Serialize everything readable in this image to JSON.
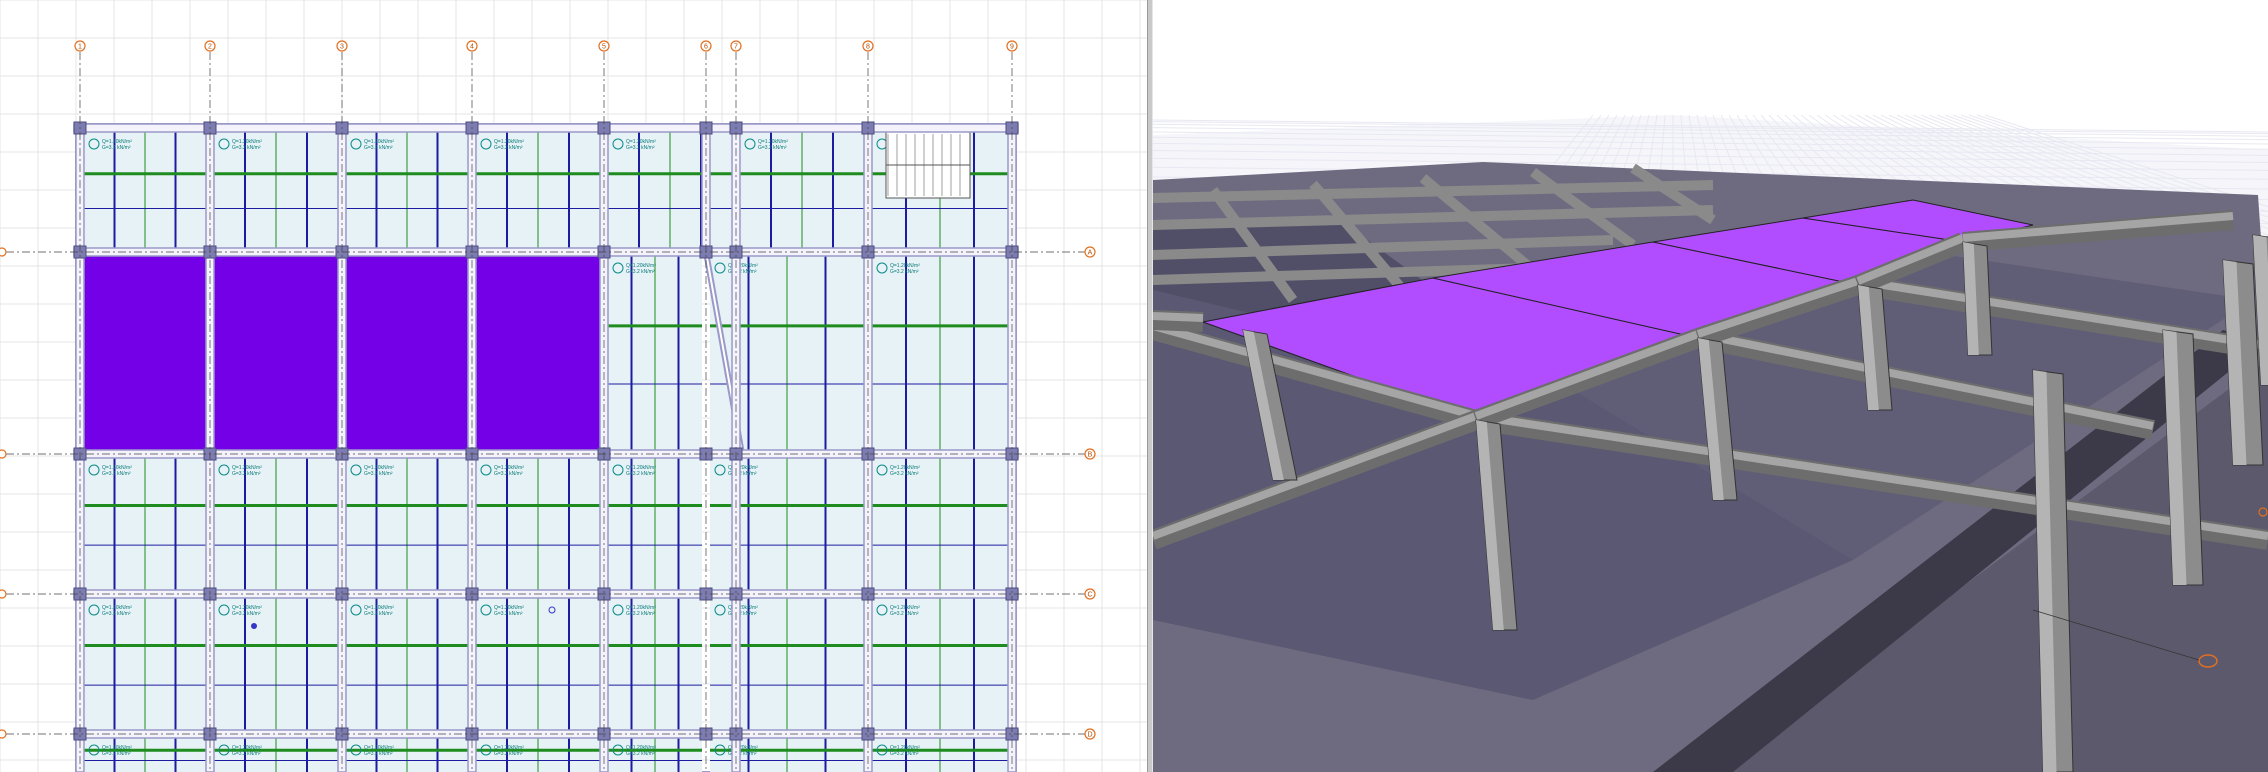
{
  "window": {
    "panes": [
      "structural-plan",
      "3d-view"
    ]
  },
  "plan": {
    "axis_markers_top": [
      "1",
      "2",
      "3",
      "4",
      "5",
      "6",
      "7",
      "8",
      "9"
    ],
    "axis_markers_side": [
      "A",
      "B",
      "C",
      "D"
    ],
    "slab_note_line1": "Q=1.20kN/m²",
    "slab_note_line2": "G=3.2 kN/m²",
    "colors": {
      "grid": "#e4e4e4",
      "slab_fill": "#e6f2f5",
      "beam": "#9a99c8",
      "column": "#7d7cb0",
      "rib_blue": "#1c1ca0",
      "rib_green": "#1e8c1e",
      "selected_slab": "#7300e6",
      "axis_marker": "#e07020"
    }
  },
  "view3d": {
    "colors": {
      "floor_slab": "#8e8b97",
      "beam_concrete": "#8a8a8a",
      "translucent_wall": "#4a4866",
      "highlight_slab": "#b14dff",
      "ground_grid": "#e8e8f2"
    }
  }
}
